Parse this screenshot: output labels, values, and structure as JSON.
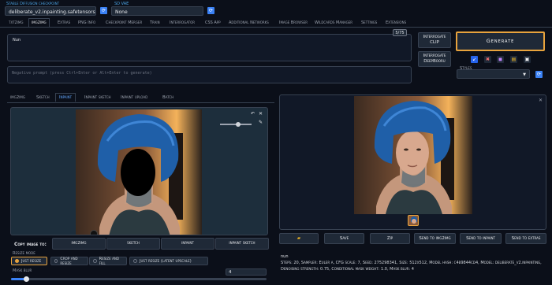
{
  "header": {
    "checkpoint_label": "Stable Diffusion checkpoint",
    "checkpoint_value": "deliberate_v2.inpainting.safetensors",
    "vae_label": "SD VAE",
    "vae_value": "None"
  },
  "tabs": [
    "txt2img",
    "img2img",
    "Extras",
    "PNG Info",
    "Checkpoint Merger",
    "Train",
    "Interrogator",
    "CSS App",
    "Additional Networks",
    "Image Browser",
    "Wildcards Manager",
    "Settings",
    "Extensions"
  ],
  "prompt": {
    "value": "Nun",
    "token_count": "5/75",
    "negative_placeholder": "Negative prompt (press Ctrl+Enter or Alt+Enter to generate)"
  },
  "buttons": {
    "interrogate_clip": "Interrogate CLIP",
    "interrogate_deepbooru": "Interrogate DeepBooru",
    "generate": "Generate"
  },
  "styles": {
    "label": "Styles"
  },
  "subtabs": [
    "img2img",
    "Sketch",
    "Inpaint",
    "Inpaint sketch",
    "Inpaint upload",
    "Batch"
  ],
  "copy": {
    "label": "Copy image to:",
    "targets": [
      "img2img",
      "sketch",
      "inpaint",
      "inpaint sketch"
    ]
  },
  "resize": {
    "label": "Resize mode",
    "options": [
      "Just resize",
      "Crop and resize",
      "Resize and fill",
      "Just resize (latent upscale)"
    ]
  },
  "mask_blur": {
    "label": "Mask blur",
    "value": "4",
    "fraction": 0.06
  },
  "output_actions": [
    "",
    "Save",
    "Zip",
    "Send to img2img",
    "Send to inpaint",
    "Send to extras"
  ],
  "info": {
    "prompt": "nun",
    "params": "Steps: 20, Sampler: Euler a, CFG scale: 7, Seed: 275298341, Size: 512x512, Model hash: c4b9844cd4, Model: deliberate_v2.inpainting, Denoising strength: 0.75, Conditional mask weight: 1.0, Mask blur: 4"
  },
  "colors": {
    "accent": "#3b82f6",
    "generate_border": "#e8a33d",
    "background": "#0b0f19"
  }
}
